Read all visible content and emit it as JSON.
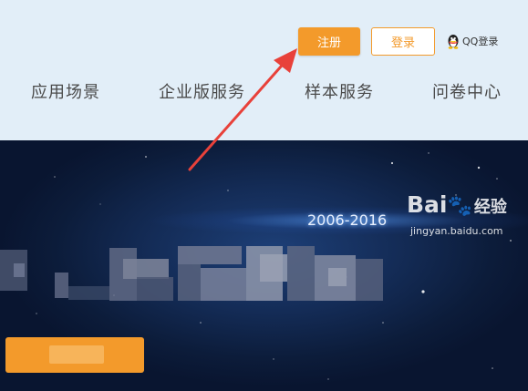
{
  "header": {
    "register_label": "注册",
    "login_label": "登录",
    "qq_login_label": "QQ登录",
    "qq_icon": "qq-penguin-icon"
  },
  "nav": {
    "items": [
      {
        "label": "应用场景"
      },
      {
        "label": "企业版服务"
      },
      {
        "label": "样本服务"
      },
      {
        "label": "问卷中心"
      }
    ]
  },
  "hero": {
    "years": "2006-2016",
    "headline_status": "pixelated",
    "cta_status": "pixelated"
  },
  "annotation": {
    "arrow_color": "#e8413a",
    "target": "注册"
  },
  "watermark": {
    "logo": "Bai",
    "logo_suffix": "经验",
    "url": "jingyan.baidu.com"
  },
  "colors": {
    "accent": "#f39a2b",
    "header_bg": "#e2eef8",
    "hero_bg": "#142c57"
  }
}
